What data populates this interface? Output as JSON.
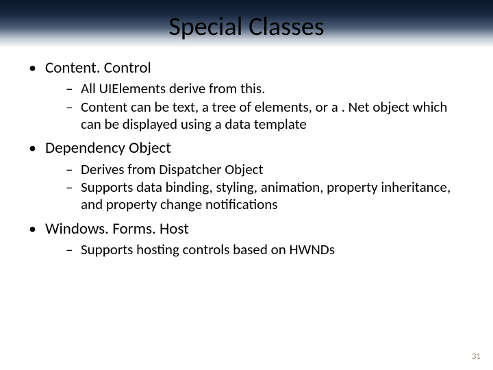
{
  "title": "Special Classes",
  "bullets": [
    {
      "label": "Content. Control",
      "sub": [
        "All UIElements derive from this.",
        "Content can be text, a tree of elements, or a . Net object which can be displayed using a data template"
      ]
    },
    {
      "label": "Dependency Object",
      "sub": [
        "Derives from Dispatcher Object",
        "Supports data binding, styling, animation, property inheritance, and property change notifications"
      ]
    },
    {
      "label": "Windows. Forms. Host",
      "sub": [
        "Supports hosting controls based on HWNDs"
      ]
    }
  ],
  "page_number": "31"
}
